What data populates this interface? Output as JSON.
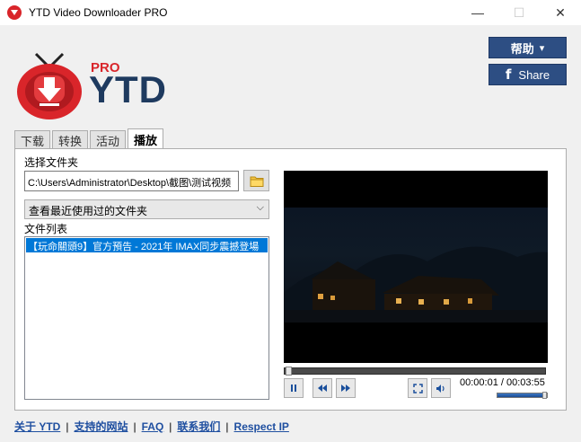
{
  "window": {
    "title": "YTD Video Downloader PRO",
    "minimize": "—",
    "maximize": "☐",
    "close": "✕"
  },
  "header": {
    "logo_pro": "PRO",
    "logo_text": "YTD",
    "help_label": "帮助",
    "help_caret": "▾",
    "share_icon": "f",
    "share_label": "Share"
  },
  "tabs": [
    {
      "label": "下载",
      "active": false
    },
    {
      "label": "转换",
      "active": false
    },
    {
      "label": "活动",
      "active": false
    },
    {
      "label": "播放",
      "active": true
    }
  ],
  "player": {
    "select_folder_label": "选择文件夹",
    "folder_path": "C:\\Users\\Administrator\\Desktop\\截图\\测试视频",
    "folder_icon": "folder-icon",
    "recent_folders_label": "查看最近使用过的文件夹",
    "file_list_label": "文件列表",
    "files": [
      "【玩命關頭9】官方預告 - 2021年 IMAX同步震撼登場"
    ],
    "time_display": "00:00:01 / 00:03:55",
    "progress_fraction": 0.004,
    "volume_fraction": 1.0
  },
  "footer": {
    "links": [
      "关于 YTD",
      "支持的网站",
      "FAQ",
      "联系我们",
      "Respect IP"
    ],
    "separator": "|"
  },
  "colors": {
    "accent_blue": "#2d4e83",
    "selection_blue": "#0078d7",
    "logo_red": "#d9252a",
    "logo_navy": "#1e3a5f",
    "link_blue": "#1f4fa0"
  }
}
